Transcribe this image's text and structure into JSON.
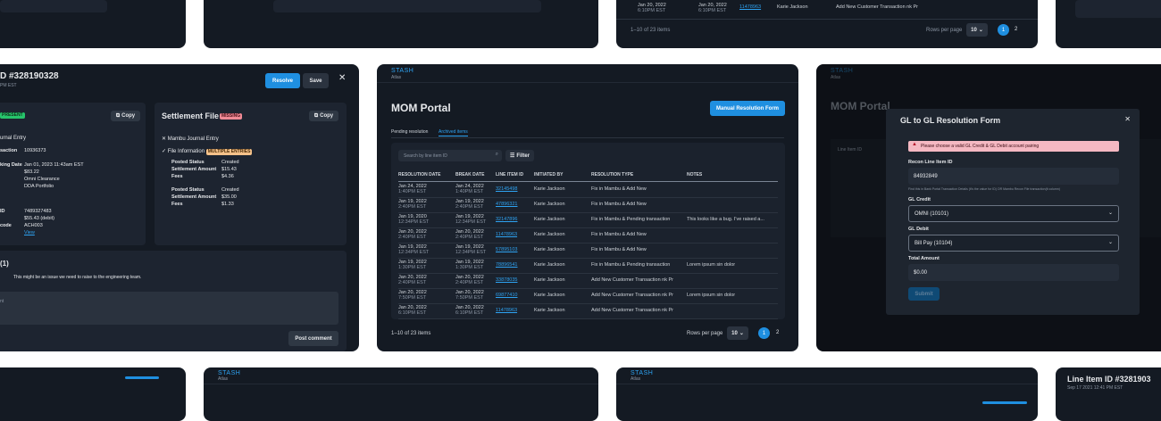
{
  "colors": {
    "accent": "#1f8fe0",
    "card": "#141a23",
    "panel": "#1d2430",
    "alert": "#f5b8c2",
    "missing": "#f08a95",
    "multiple": "#f5c28a",
    "success": "#27c46b"
  },
  "brand": {
    "logo": "STASH",
    "sub": "Atlas"
  },
  "top_cards": {
    "rows": [
      {
        "break": "Jan 20, 2022",
        "break_time": "6:10PM EST",
        "break2": "Jan 20, 2022",
        "break2_time": "6:10PM EST",
        "id": "11478963",
        "by": "Karie Jackson",
        "type": "Add New Customer Transaction nk Pr"
      }
    ],
    "count": "1–10 of 23 items",
    "rpp": "Rows per page",
    "rpp_val": "10",
    "page1": "1",
    "page2": "2"
  },
  "detail": {
    "title": "D #328190328",
    "subtitle": "PM EST",
    "resolve": "Resolve",
    "save": "Save",
    "left_badge": "PRESENT",
    "copy": "Copy",
    "journal": "urnal Entry",
    "kv": [
      {
        "k": "saction",
        "v": "10936373"
      },
      {
        "k": "king Date",
        "v": "Jan 01, 2023 11:43am EST"
      },
      {
        "k": "",
        "v": "$83.22"
      },
      {
        "k": "",
        "v": "Omni Clearance"
      },
      {
        "k": "",
        "v": "DDA Portfolio"
      },
      {
        "k": "ID",
        "v": "7489327483"
      },
      {
        "k": "",
        "v": "$55.43 (debit)"
      },
      {
        "k": "code",
        "v": "ACH003"
      }
    ],
    "view": "View",
    "settlement_title": "Settlement File",
    "settlement_badge": "MISSING",
    "mambu": "Mambu Journal Entry",
    "file_info": "File Information",
    "multiple": "MULTIPLE ENTRIES",
    "g1": [
      {
        "k": "Posted Status",
        "v": "Created"
      },
      {
        "k": "Settlement Amount",
        "v": "$15.43"
      },
      {
        "k": "Fees",
        "v": "$4.36"
      }
    ],
    "g2": [
      {
        "k": "Posted Status",
        "v": "Created"
      },
      {
        "k": "Settlement Amount",
        "v": "$35.00"
      },
      {
        "k": "Fees",
        "v": "$1.33"
      }
    ],
    "comments": "(1)",
    "comment": "This might be an issue we need to raise to the engineering team.",
    "comment_ph": "nt",
    "post": "Post comment"
  },
  "mom": {
    "title": "MOM Portal",
    "manual": "Manual Resolution Form",
    "tab_pending": "Pending resolution",
    "tab_archived": "Archived items",
    "search_ph": "Search by line item ID",
    "filter": "Filter",
    "headers": [
      "RESOLUTION DATE",
      "BREAK DATE",
      "LINE ITEM ID",
      "INITIATED BY",
      "RESOLUTION TYPE",
      "NOTES"
    ],
    "rows": [
      {
        "rd": "Jan 24, 2022",
        "rt": "1:40PM EST",
        "bd": "Jan 24, 2022",
        "bt": "1:40PM EST",
        "id": "32145498",
        "by": "Karie Jackson",
        "type": "Fix in Mambu & Add New",
        "notes": ""
      },
      {
        "rd": "Jan 19, 2022",
        "rt": "2:40PM EST",
        "bd": "Jan 19, 2022",
        "bt": "2:40PM EST",
        "id": "47896321",
        "by": "Karie Jackson",
        "type": "Fix in Mambu & Add New",
        "notes": ""
      },
      {
        "rd": "Jan 19, 2020",
        "rt": "12:34PM EST",
        "bd": "Jan 19, 2022",
        "bt": "12:34PM EST",
        "id": "32147896",
        "by": "Karie Jackson",
        "type": "Fix in Mambu & Pending transaction",
        "notes": "This looks like a bug. I've raised a..."
      },
      {
        "rd": "Jan 20, 2022",
        "rt": "2:40PM EST",
        "bd": "Jan 20, 2022",
        "bt": "2:40PM EST",
        "id": "11478963",
        "by": "Karie Jackson",
        "type": "Fix in Mambu & Add New",
        "notes": ""
      },
      {
        "rd": "Jan 19, 2022",
        "rt": "12:34PM EST",
        "bd": "Jan 19, 2022",
        "bt": "12:34PM EST",
        "id": "57895103",
        "by": "Karie Jackson",
        "type": "Fix in Mambu & Add New",
        "notes": ""
      },
      {
        "rd": "Jan 19, 2022",
        "rt": "1:30PM EST",
        "bd": "Jan 19, 2022",
        "bt": "1:30PM EST",
        "id": "78896541",
        "by": "Karie Jackson",
        "type": "Fix in Mambu & Pending transaction",
        "notes": "Lorem ipsum sin dolor"
      },
      {
        "rd": "Jan 20, 2022",
        "rt": "2:40PM EST",
        "bd": "Jan 20, 2022",
        "bt": "2:40PM EST",
        "id": "33878035",
        "by": "Karie Jackson",
        "type": "Add New Customer Transaction nk Pr",
        "notes": ""
      },
      {
        "rd": "Jan 20, 2022",
        "rt": "7:50PM EST",
        "bd": "Jan 20, 2022",
        "bt": "7:50PM EST",
        "id": "69877410",
        "by": "Karie Jackson",
        "type": "Add New Customer Transaction nk Pr",
        "notes": "Lorem ipsum sin dolor"
      },
      {
        "rd": "Jan 20, 2022",
        "rt": "6:10PM EST",
        "bd": "Jan 20, 2022",
        "bt": "6:10PM EST",
        "id": "11478963",
        "by": "Karie Jackson",
        "type": "Add New Customer Transaction nk Pr",
        "notes": ""
      }
    ],
    "count": "1–10 of 23 items",
    "rpp": "Rows per page",
    "rpp_val": "10",
    "page1": "1",
    "page2": "2"
  },
  "gl": {
    "bg_title": "MOM Portal",
    "bg_col": "Line Item ID",
    "title": "GL to GL Resolution Form",
    "alert": "Please choose a valid GL Credit & GL Debit account pairing",
    "recon_label": "Recon Line Item ID",
    "recon_val": "84932849",
    "hint": "Find this in Bank Portal Transaction Details (it's the value for ID) OR Mambu Recon File transaction(it column)",
    "credit_label": "GL Credit",
    "credit_val": "OMNI (10101)",
    "debit_label": "GL Debit",
    "debit_val": "Bill Pay (10104)",
    "amount_label": "Total Amount",
    "amount_val": "$0.00",
    "submit": "Submit"
  },
  "bottom": {
    "title": "Line Item ID #3281903",
    "sub": "Sep 17 2021 12:41 PM EST"
  }
}
